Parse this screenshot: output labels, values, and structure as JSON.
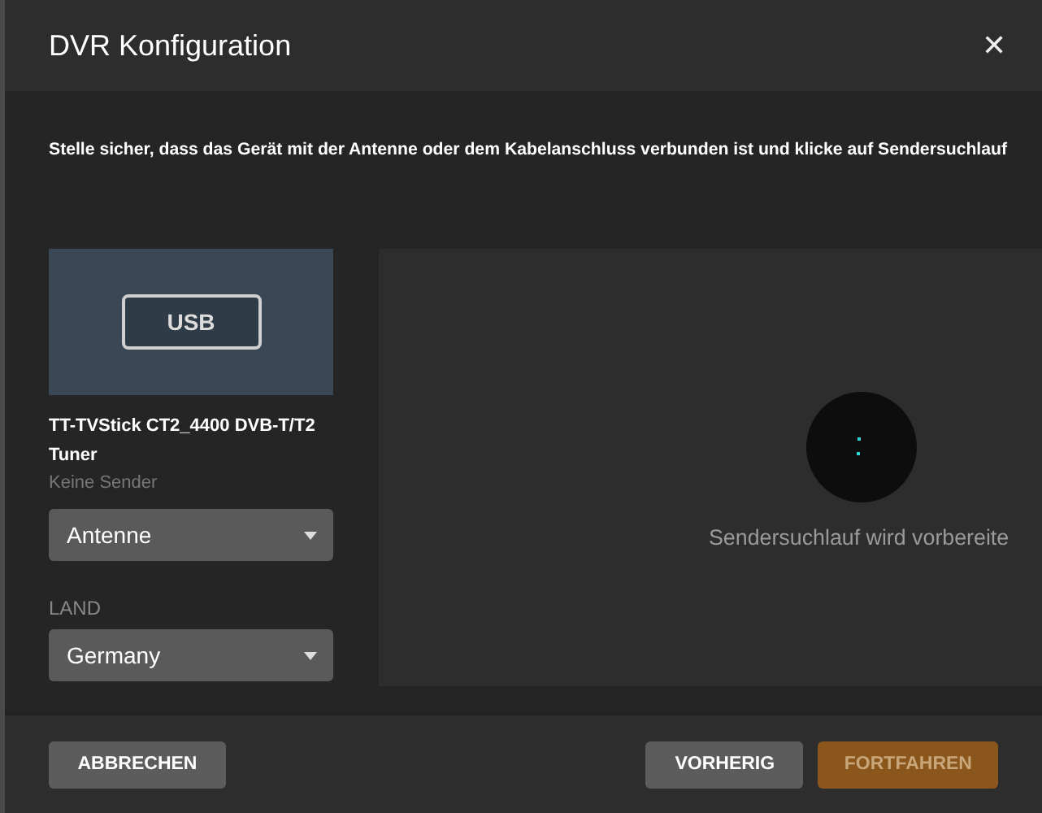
{
  "dialog": {
    "title": "DVR Konfiguration",
    "close": "✕"
  },
  "instruction": "Stelle sicher, dass das Gerät mit der Antenne oder dem Kabelanschluss verbunden ist und klicke auf Sendersuchlauf",
  "device": {
    "badge": "USB",
    "name": "TT-TVStick CT2_4400 DVB-T/T2 Tuner",
    "status": "Keine Sender"
  },
  "source_select": {
    "value": "Antenne"
  },
  "country": {
    "label": "LAND",
    "value": "Germany"
  },
  "scan": {
    "message": "Sendersuchlauf wird vorbereite"
  },
  "buttons": [
    {
      "label": "ABBRECHEN",
      "kind": "secondary",
      "disabled": false
    },
    {
      "label": "VORHERIG",
      "kind": "secondary",
      "disabled": false
    },
    {
      "label": "FORTFAHREN",
      "kind": "primary",
      "disabled": true
    }
  ]
}
